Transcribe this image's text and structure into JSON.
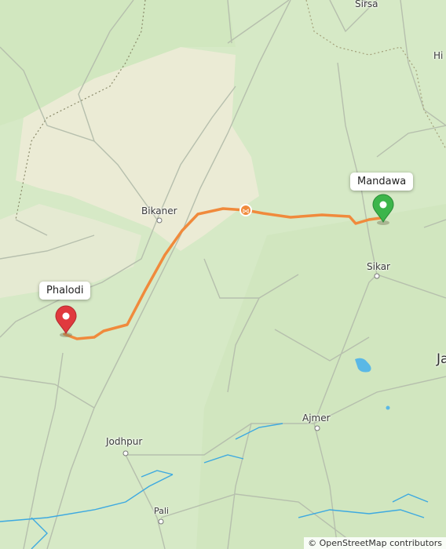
{
  "map": {
    "places": [
      {
        "id": "sirsa",
        "label": "Sirsa"
      },
      {
        "id": "hisar",
        "label": "Hi"
      },
      {
        "id": "bikaner",
        "label": "Bikaner"
      },
      {
        "id": "sikar",
        "label": "Sikar"
      },
      {
        "id": "jaipur",
        "label": "Ja"
      },
      {
        "id": "ajmer",
        "label": "Ajmer"
      },
      {
        "id": "jodhpur",
        "label": "Jodhpur"
      },
      {
        "id": "pali",
        "label": "Pali"
      }
    ],
    "start_marker": {
      "label": "Phalodi",
      "color": "#e0393e"
    },
    "end_marker": {
      "label": "Mandawa",
      "color": "#3cb54a"
    },
    "route": {
      "color": "#f08a3c"
    },
    "attribution": "© OpenStreetMap contributors",
    "colors": {
      "land": "#d6e9c6",
      "desert": "#efeedd",
      "water": "#3da9e0",
      "road": "#b9c3b0",
      "border": "#8a8a6a"
    }
  }
}
